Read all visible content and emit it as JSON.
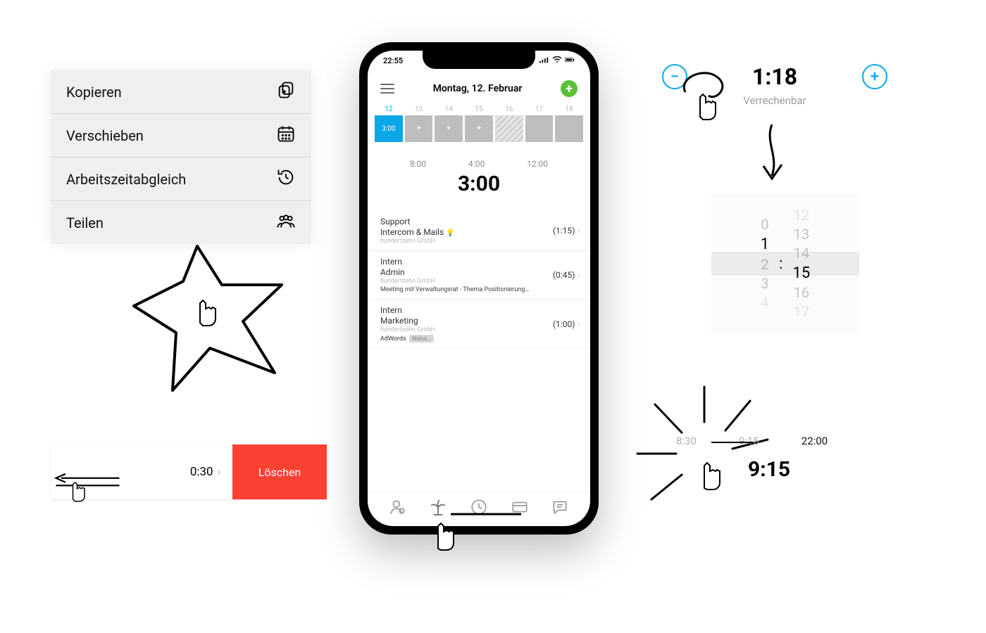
{
  "context_menu": {
    "items": [
      {
        "label": "Kopieren",
        "icon": "copy-icon"
      },
      {
        "label": "Verschieben",
        "icon": "calendar-icon"
      },
      {
        "label": "Arbeitszeitabgleich",
        "icon": "history-icon"
      },
      {
        "label": "Teilen",
        "icon": "people-icon"
      }
    ]
  },
  "swipe_row": {
    "duration": "0:30",
    "delete_label": "Löschen"
  },
  "phone": {
    "status_time": "22:55",
    "header_title": "Montag, 12. Februar",
    "week_days": [
      {
        "num": "12",
        "label": "3:00",
        "active": true
      },
      {
        "num": "13",
        "icon": "plane"
      },
      {
        "num": "14",
        "icon": "plane"
      },
      {
        "num": "15",
        "icon": "plane"
      },
      {
        "num": "16",
        "hatched": true
      },
      {
        "num": "17"
      },
      {
        "num": "18"
      }
    ],
    "totals": {
      "a": "8:00",
      "b": "4:00",
      "c": "12:00"
    },
    "big_total": "3:00",
    "entries": [
      {
        "category": "Support",
        "project": "Intercom & Mails",
        "has_lamp": true,
        "client": "hundertzehn GmbH",
        "duration": "(1:15)"
      },
      {
        "category": "Intern",
        "project": "Admin",
        "client": "hundertzehn GmbH",
        "note": "Meeting mit Verwaltungsrat - Thema Positionierung…",
        "duration": "(0:45)"
      },
      {
        "category": "Intern",
        "project": "Marketing",
        "client": "hundertzehn GmbH",
        "tags": {
          "t1": "AdWords",
          "t2": "Websi…"
        },
        "duration": "(1:00)"
      }
    ]
  },
  "stepper": {
    "value": "1:18",
    "billable_label": "Verrechenbar"
  },
  "picker": {
    "hours": [
      "0",
      "1",
      "2",
      "3",
      "4"
    ],
    "hours_selected_index": 1,
    "minutes": [
      "12",
      "13",
      "14",
      "15",
      "16",
      "17"
    ],
    "minutes_selected_index": 3
  },
  "time_strip": {
    "t1": "8:30",
    "t2": "9:15",
    "t3": "22:00",
    "big": "9:15"
  }
}
